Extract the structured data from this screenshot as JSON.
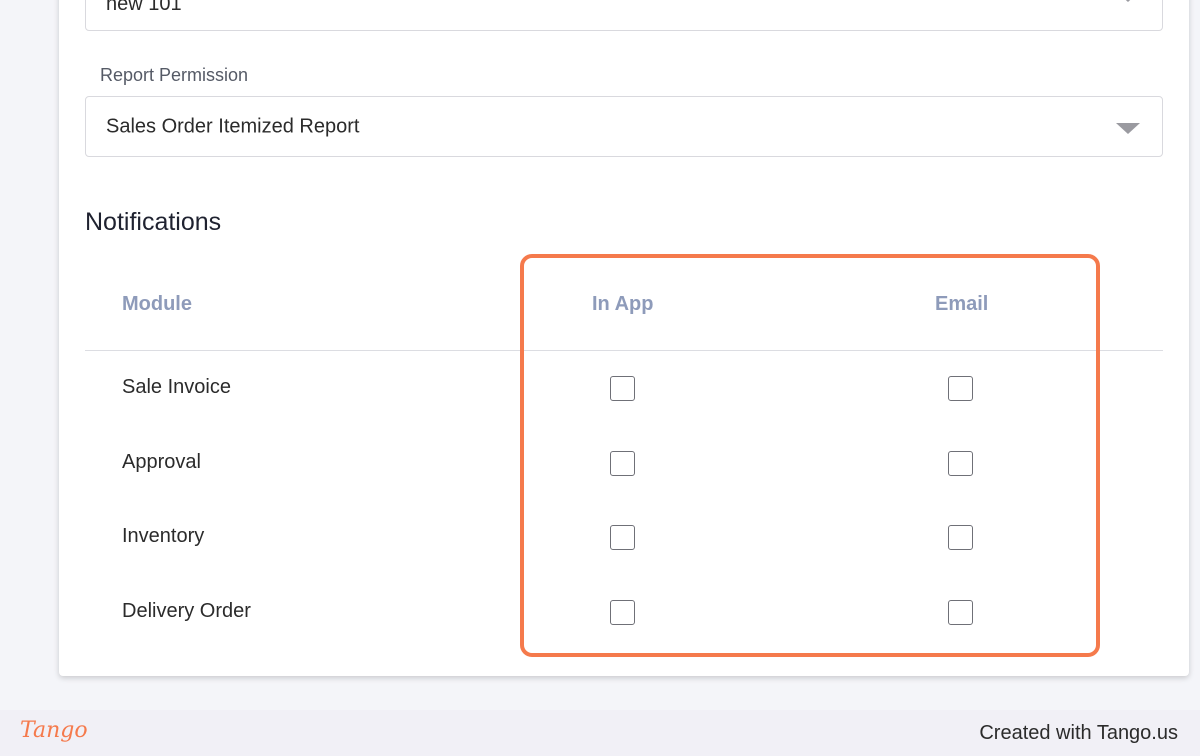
{
  "form": {
    "top_select_value": "new 101",
    "report_permission_label": "Report Permission",
    "report_permission_value": "Sales Order Itemized Report"
  },
  "notifications": {
    "title": "Notifications",
    "columns": {
      "module": "Module",
      "in_app": "In App",
      "email": "Email"
    },
    "rows": [
      {
        "label": "Sale Invoice",
        "in_app": false,
        "email": false
      },
      {
        "label": "Approval",
        "in_app": false,
        "email": false
      },
      {
        "label": "Inventory",
        "in_app": false,
        "email": false
      },
      {
        "label": "Delivery Order",
        "in_app": false,
        "email": false
      }
    ]
  },
  "footer": {
    "logo": "Tango",
    "credit": "Created with Tango.us"
  },
  "colors": {
    "highlight": "#f57a4c",
    "column_header": "#8e9bba"
  }
}
